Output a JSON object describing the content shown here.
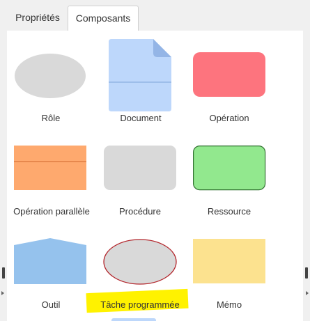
{
  "tabs": [
    {
      "label": "Propriétés",
      "active": false
    },
    {
      "label": "Composants",
      "active": true
    }
  ],
  "shapes": [
    {
      "label": "Rôle",
      "shape": "ellipse",
      "fill": "#d9d9d9"
    },
    {
      "label": "Document",
      "shape": "document-icon",
      "fill": "#bdd7fb"
    },
    {
      "label": "Opération",
      "shape": "rounded-rectangle",
      "fill": "#fd747e"
    },
    {
      "label": "Opération parallèle",
      "shape": "split-rectangle",
      "fill": "#fea96e"
    },
    {
      "label": "Procédure",
      "shape": "rounded-rectangle",
      "fill": "#d9d9d9"
    },
    {
      "label": "Ressource",
      "shape": "rounded-rectangle",
      "fill": "#92e88e"
    },
    {
      "label": "Outil",
      "shape": "house-pentagon",
      "fill": "#95c2ed"
    },
    {
      "label": "Tâche programmée",
      "shape": "ellipse-outlined",
      "fill": "#d9d9d9",
      "highlight": "#fff200"
    },
    {
      "label": "Mémo",
      "shape": "rectangle",
      "fill": "#fce28f"
    }
  ]
}
